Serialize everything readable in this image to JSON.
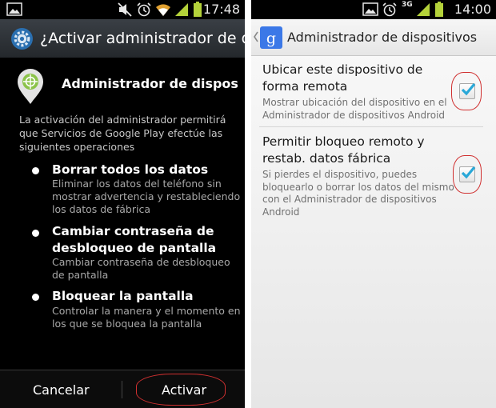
{
  "left_screen": {
    "status_bar": {
      "time": "17:48"
    },
    "header": {
      "title": "¿Activar administrador de di..."
    },
    "app": {
      "name": "Administrador de dispositi..."
    },
    "intro": "La activación del administrador permitirá que Servicios de Google Play efectúe las siguientes operaciones",
    "permissions": [
      {
        "title": "Borrar todos los datos",
        "description": "Eliminar los datos del teléfono sin mostrar advertencia y restableciendo los datos de fábrica"
      },
      {
        "title": "Cambiar contraseña de desbloqueo de pantalla",
        "description": "Cambiar contraseña de desbloqueo de pantalla"
      },
      {
        "title": "Bloquear la pantalla",
        "description": "Controlar la manera y el momento en los que se bloquea la pantalla"
      }
    ],
    "buttons": {
      "cancel": "Cancelar",
      "activate": "Activar"
    }
  },
  "right_screen": {
    "status_bar": {
      "time": "14:00",
      "network": "3G"
    },
    "action_bar": {
      "title": "Administrador de dispositivos"
    },
    "settings": [
      {
        "title": "Ubicar este dispositivo de forma remota",
        "summary": "Mostrar ubicación del dispositivo en el Administrador de dispositivos Android",
        "checked": true
      },
      {
        "title": "Permitir bloqueo remoto y restab. datos fábrica",
        "summary": "Si pierdes el dispositivo, puedes bloquearlo o borrar los datos del mismo con el Administrador de dispositivos Android",
        "checked": true
      }
    ]
  },
  "colors": {
    "annotation": "#d03030",
    "checkmark": "#29a8d8",
    "google_blue": "#3b78e7"
  }
}
